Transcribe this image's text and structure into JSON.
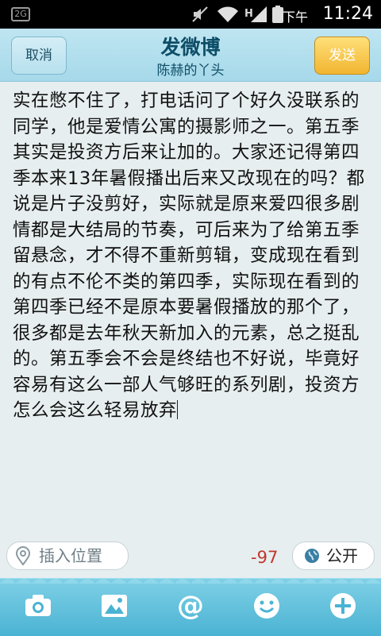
{
  "status_bar": {
    "left_badge": "2G",
    "signal_label": "H",
    "ampm": "下午",
    "time": "11:24"
  },
  "header": {
    "title": "发微博",
    "subtitle": "陈赫的丫头",
    "cancel_label": "取消",
    "send_label": "发送"
  },
  "editor": {
    "text": "实在憋不住了，打电话问了个好久没联系的同学，他是爱情公寓的摄影师之一。第五季其实是投资方后来让加的。大家还记得第四季本来13年暑假播出后来又改现在的吗？都说是片子没剪好，实际就是原来爱四很多剧情都是大结局的节奏，可后来为了给第五季留悬念，才不得不重新剪辑，变成现在看到的有点不伦不类的第四季，实际现在看到的第四季已经不是原本要暑假播放的那个了，很多都是去年秋天新加入的元素，总之挺乱的。第五季会不会是终结也不好说，毕竟好容易有这么一部人气够旺的系列剧，投资方怎么会这么轻易放弃"
  },
  "footer": {
    "location_label": "插入位置",
    "char_count": "-97",
    "visibility_label": "公开"
  },
  "toolbar": {
    "items": [
      "camera-icon",
      "image-icon",
      "mention-icon",
      "emoji-icon",
      "add-icon"
    ]
  },
  "colors": {
    "header_bg": "#a6d9ea",
    "send_button": "#f1b530",
    "count_text": "#c2362c",
    "toolbar_bg": "#4ab3d3"
  }
}
